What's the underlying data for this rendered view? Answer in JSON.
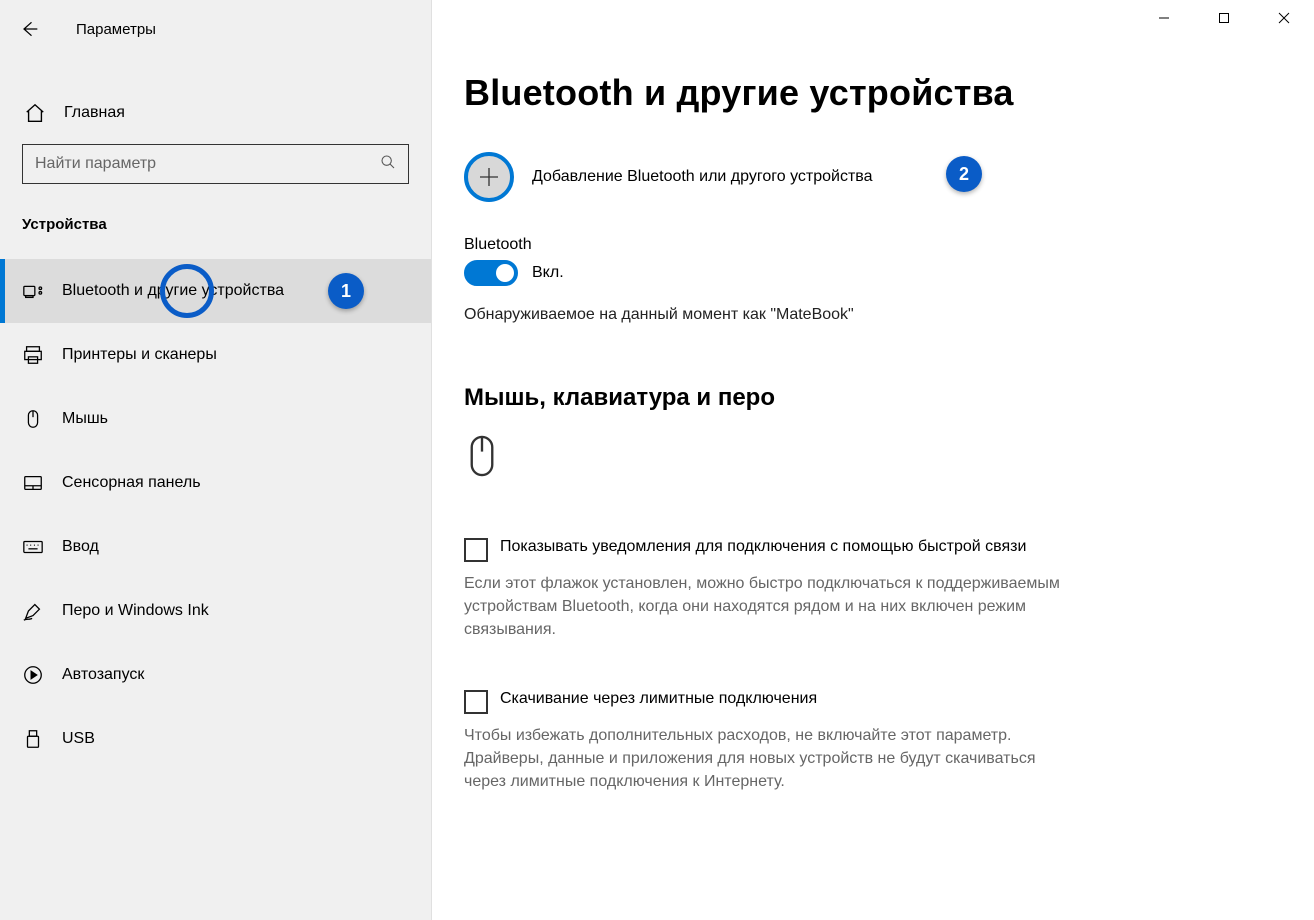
{
  "window": {
    "title": "Параметры",
    "home": "Главная",
    "search_placeholder": "Найти параметр",
    "section": "Устройства"
  },
  "nav": [
    {
      "label": "Bluetooth и другие устройства",
      "icon": "bluetooth-devices"
    },
    {
      "label": "Принтеры и сканеры",
      "icon": "printer"
    },
    {
      "label": "Мышь",
      "icon": "mouse"
    },
    {
      "label": "Сенсорная панель",
      "icon": "touchpad"
    },
    {
      "label": "Ввод",
      "icon": "keyboard"
    },
    {
      "label": "Перо и Windows Ink",
      "icon": "pen"
    },
    {
      "label": "Автозапуск",
      "icon": "autoplay"
    },
    {
      "label": "USB",
      "icon": "usb"
    }
  ],
  "main": {
    "title": "Bluetooth и другие устройства",
    "add_device": "Добавление Bluetooth или другого устройства",
    "bluetooth_label": "Bluetooth",
    "toggle_state": "Вкл.",
    "discoverable": "Обнаруживаемое на данный момент как \"MateBook\"",
    "section2": "Мышь, клавиатура и перо",
    "checkbox1_label": "Показывать уведомления для подключения с помощью быстрой связи",
    "checkbox1_help": "Если этот флажок установлен, можно быстро подключаться к поддерживаемым устройствам Bluetooth, когда они находятся рядом и на них включен режим связывания.",
    "checkbox2_label": "Скачивание через лимитные подключения",
    "checkbox2_help": "Чтобы избежать дополнительных расходов, не включайте этот параметр. Драйверы, данные и приложения для новых устройств не будут скачиваться через лимитные подключения к Интернету."
  },
  "annotations": {
    "one": "1",
    "two": "2"
  }
}
